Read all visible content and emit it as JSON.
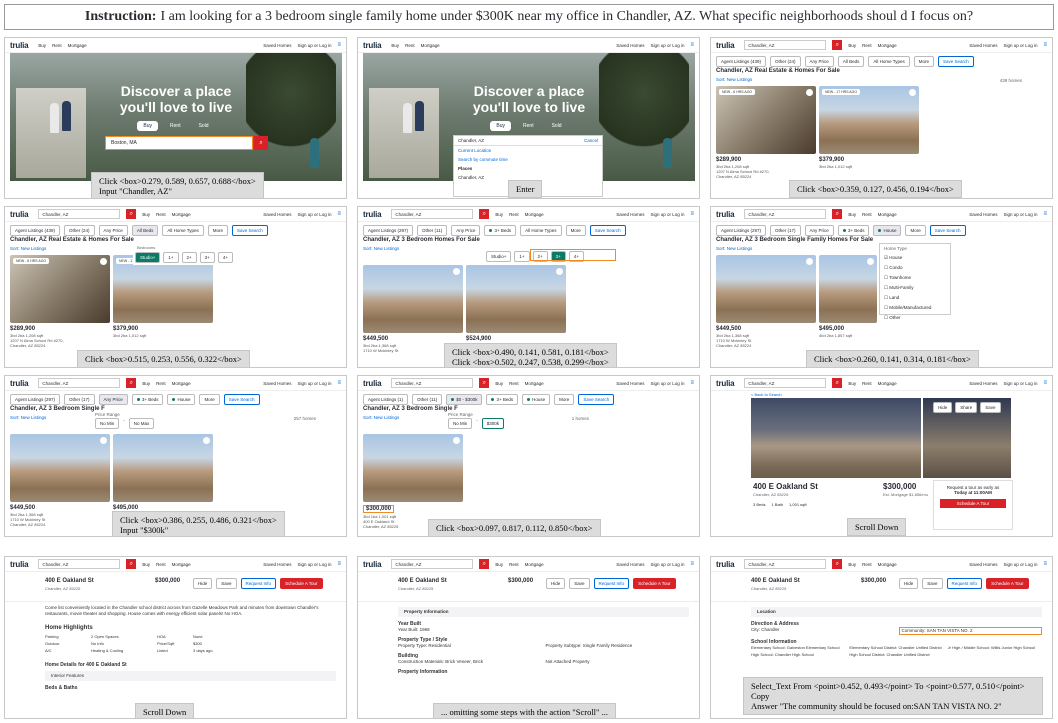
{
  "instruction": {
    "label": "Instruction:",
    "text": "I am looking for a 3 bedroom single family home under $300K near my office in Chandler, AZ. What specific neighborhoods shoul d I focus on?"
  },
  "nav": {
    "logo": "trulia",
    "buy": "Buy",
    "rent": "Rent",
    "mortgage": "Mortgage",
    "saved_homes": "Saved Homes",
    "saved_searches": "Saved Searches",
    "signup": "Sign up or Log in",
    "location": "Chandler, AZ"
  },
  "hero": {
    "headline_1": "Discover a place",
    "headline_2": "you'll love to live",
    "tab_buy": "Buy",
    "tab_rent": "Rent",
    "tab_sold": "Sold",
    "search_value": "Boston, MA",
    "search_value_2": "Chandler, AZ",
    "cancel": "Cancel",
    "current_location": "Current Location",
    "commute": "Search by commute time",
    "places": "Places",
    "place_1": "Chandler, AZ"
  },
  "filters": {
    "agent": "Agent Listings (439)",
    "agent2": "Agent Listings (297)",
    "agent3": "Agent Listings (1)",
    "other": "Other (24)",
    "other2": "Other (17)",
    "other3": "Other (11)",
    "any_price": "Any Price",
    "all_beds": "All Beds",
    "beds3": "3+ Beds",
    "all_types": "All Home Types",
    "house": "House",
    "more": "More",
    "save": "Save Search",
    "price300": "$0 - $300k",
    "bedrooms": "Bedrooms",
    "studio": "Studio+",
    "b1": "1+",
    "b2": "2+",
    "b3": "3+",
    "b4": "4+",
    "price_range": "Price Range",
    "no_min": "No Min",
    "no_max": "No Max",
    "max300": "$300k",
    "home_type": "Home Type"
  },
  "home_types": [
    "House",
    "Condo",
    "Townhome",
    "Multi-Family",
    "Land",
    "Mobile/Manufactured",
    "Other"
  ],
  "results": {
    "title_1": "Chandler, AZ Real Estate & Homes For Sale",
    "title_2": "Chandler, AZ 3 Bedroom Homes For Sale",
    "title_3": "Chandler, AZ 3 Bedroom Single Family Homes For Sale",
    "title_4": "Chandler, AZ 3 Bedroom Single F",
    "sort": "Sort: New Listings",
    "count_1": "439 homes",
    "count_2": "257 homes",
    "count_3": "1 homes"
  },
  "listings": [
    {
      "price": "$289,900",
      "meta": "3bd 2ba 1,208 sqft",
      "addr": "1207 N Alma School Rd #270,",
      "city": "Chandler, AZ 85224",
      "tag": "NEW - 6 HRS AGO"
    },
    {
      "price": "$379,900",
      "meta": "3bd 2ba 1,012 sqft",
      "tag": "NEW - 17 HRS AGO"
    },
    {
      "price": "$449,500",
      "meta": "3bd 2ba 1,368 sqft",
      "addr": "1710 W Mckinley St",
      "city": "Chandler, AZ 85224"
    },
    {
      "price": "$524,900"
    },
    {
      "price": "$495,000",
      "meta": "4bd 2ba 1,857 sqft"
    },
    {
      "price": "$300,000",
      "meta": "3bd 1ba 1,001 sqft",
      "addr": "400 E Oakland St",
      "city": "Chandler, AZ 85225"
    }
  ],
  "detail": {
    "address": "400 E Oakland St",
    "city": "Chandler, AZ 85225",
    "price": "$300,000",
    "est": "Est. Mortgage $1,856/mo",
    "beds": "3 Beds",
    "baths": "1 Bath",
    "sqft": "1,001 sqft",
    "hide": "Hide",
    "share": "Share",
    "save": "Save",
    "request": "Request Info",
    "tour": "Schedule A Tour",
    "tour_q": "Request a tour as early as",
    "tour_t": "Today at 11:00AM",
    "back": "< Back to Search",
    "desc": "Come list conveniently located in the Chandler school district across from Gazelle Meadows Park and minutes from downtown Chandler's restaurants, movie theater and shopping. House comes with energy efficient solar panels! No HOA.",
    "highlights": "Home Highlights",
    "details_title": "Home Details for 400 E Oakland St",
    "interior": "Interior Features",
    "beds_baths": "Beds & Baths",
    "parking": "Parking",
    "parking_v": "2 Open Spaces",
    "outdoor": "Outdoor",
    "outdoor_v": "No Info",
    "ac": "A/C",
    "ac_v": "Heating & Cooling",
    "hoa": "HOA",
    "hoa_v": "None",
    "ppsf": "Price/Sqft",
    "ppsf_v": "$300",
    "listed": "Listed",
    "listed_v": "3 days ago",
    "prop_info": "Property Information",
    "year_built_h": "Year Built",
    "year_built": "Year Built: 1968",
    "prop_type_h": "Property Type / Style",
    "prop_type": "Property Type: Residential",
    "subtype": "Property Subtype: Single Family Residence",
    "building": "Building",
    "materials": "Construction Materials: Brick Veneer, Brick",
    "attached": "Not Attached Property",
    "prop_info2": "Property Information",
    "location": "Location",
    "dir_addr": "Direction & Address",
    "city_line": "City: Chandler",
    "community": "Community: SAN TAN VISTA NO. 2",
    "school_info": "School Information",
    "school_1": "Elementary School: Galveston Elementary School",
    "school_2": "Elementary School District: Chandler Unified District",
    "school_3": "Jr High / Middle School: Willis Junior High School",
    "school_4": "High School: Chandler High School",
    "school_5": "High School District: Chandler Unified District"
  },
  "captions": {
    "c1a": "Click <box>0.279, 0.589, 0.657, 0.688</box>",
    "c1b": "Input \"Chandler, AZ\"",
    "c2": "Enter",
    "c3": "Click <box>0.359, 0.127, 0.456, 0.194</box>",
    "c4": "Click <box>0.515, 0.253, 0.556, 0.322</box>",
    "c5a": "Click <box>0.490, 0.141, 0.581, 0.181</box>",
    "c5b": "Click <box>0.502, 0.247, 0.538, 0.299</box>",
    "c6": "Click <box>0.260, 0.141, 0.314, 0.181</box>",
    "c7a": "Click <box>0.386, 0.255, 0.486, 0.321</box>",
    "c7b": "Input \"$300k\"",
    "c8": "Click <box>0.097, 0.817, 0.112, 0.850</box>",
    "c9": "Scroll Down",
    "c10": "Scroll Down",
    "c11": "... omitting some steps with the action \"Scroll\" ...",
    "c12a": "Select_Text From <point>0.452, 0.493</point> To <point>0.577, 0.510</point>",
    "c12b": "Copy",
    "c12c": "Answer \"The community should be focused on:SAN TAN VISTA NO. 2\""
  }
}
